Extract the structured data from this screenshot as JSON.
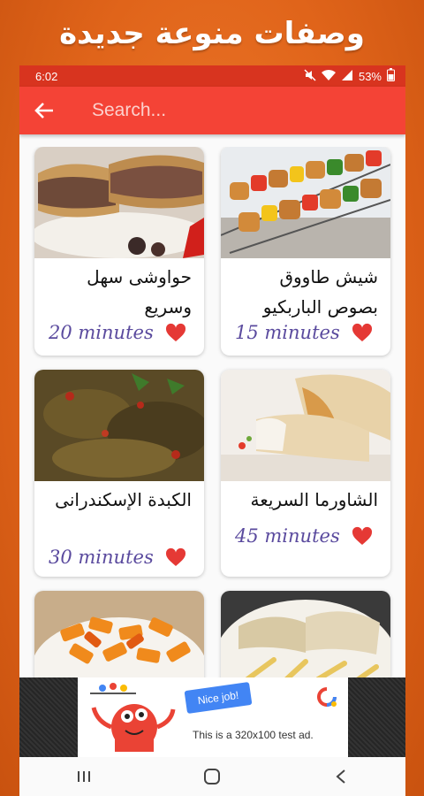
{
  "banner": {
    "title": "وصفات منوعة جديدة"
  },
  "status_bar": {
    "time": "6:02",
    "battery": "53%"
  },
  "search": {
    "placeholder": "Search..."
  },
  "recipes": [
    {
      "title": "شيش طاووق بصوص الباربكيو",
      "minutes": "15 minutes",
      "favorite": true
    },
    {
      "title": "حواوشى سهل وسريع",
      "minutes": "20 minutes",
      "favorite": true
    },
    {
      "title": "الشاورما السريعة",
      "minutes": "45 minutes",
      "favorite": true
    },
    {
      "title": "الكبدة الإسكندرانى",
      "minutes": "30 minutes",
      "favorite": true
    },
    {
      "title": "",
      "minutes": "",
      "favorite": false
    },
    {
      "title": "",
      "minutes": "",
      "favorite": false
    }
  ],
  "ad": {
    "badge": "Nice job!",
    "text": "This is a 320x100 test ad."
  },
  "colors": {
    "primary": "#f44336",
    "status": "#d8341f",
    "heart": "#e53935",
    "minutes": "#5a4a9e",
    "background": "#e0641a"
  }
}
